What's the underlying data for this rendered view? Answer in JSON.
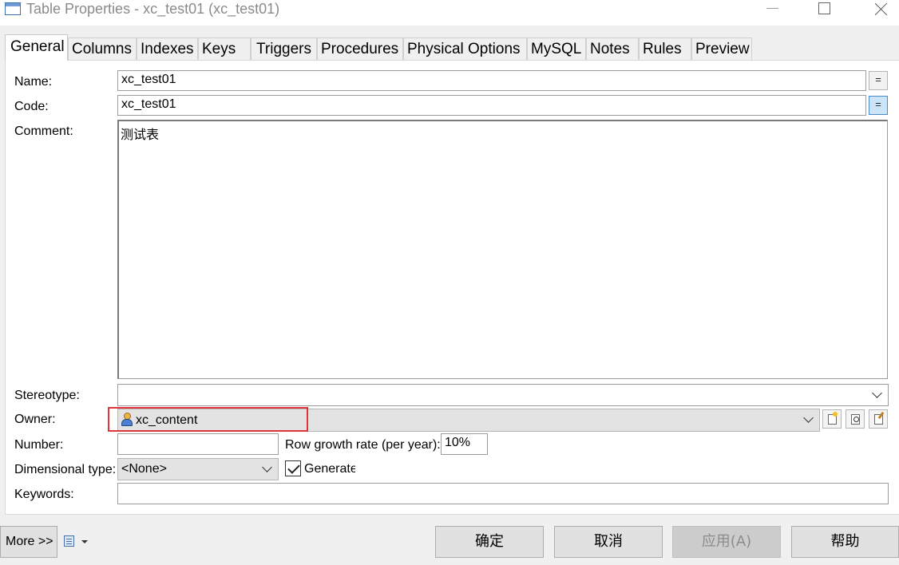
{
  "window": {
    "title": "Table Properties - xc_test01 (xc_test01)"
  },
  "tabs": [
    {
      "label": "General"
    },
    {
      "label": "Columns"
    },
    {
      "label": "Indexes"
    },
    {
      "label": "Keys"
    },
    {
      "label": "Triggers"
    },
    {
      "label": "Procedures"
    },
    {
      "label": "Physical Options"
    },
    {
      "label": "MySQL"
    },
    {
      "label": "Notes"
    },
    {
      "label": "Rules"
    },
    {
      "label": "Preview"
    }
  ],
  "form": {
    "name_label": "Name:",
    "name_value": "xc_test01",
    "code_label": "Code:",
    "code_value": "xc_test01",
    "equal_button": "=",
    "comment_label": "Comment:",
    "comment_value": "测试表",
    "stereotype_label": "Stereotype:",
    "stereotype_value": "",
    "owner_label": "Owner:",
    "owner_value": "xc_content",
    "number_label": "Number:",
    "number_value": "",
    "row_growth_label": "Row growth rate (per year):",
    "row_growth_value": "10%",
    "dimensional_label": "Dimensional type:",
    "dimensional_value": "<None>",
    "generate_label": "Generate",
    "generate_checked": true,
    "keywords_label": "Keywords:",
    "keywords_value": ""
  },
  "footer": {
    "more_label": "More >>",
    "ok_label": "确定",
    "cancel_label": "取消",
    "apply_label": "应用(A)",
    "help_label": "帮助"
  },
  "colors": {
    "highlight_border": "#e0333a",
    "pressed_button": "#cce4f7"
  }
}
